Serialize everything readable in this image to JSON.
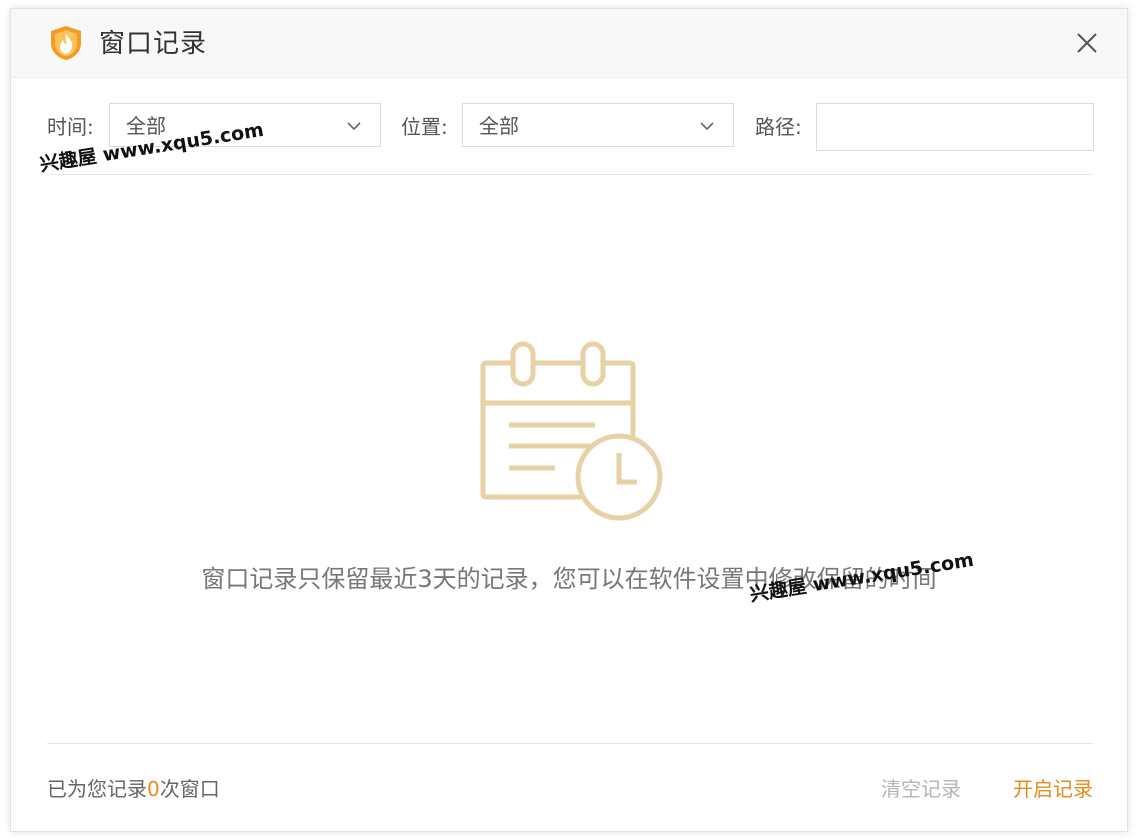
{
  "window": {
    "title": "窗口记录",
    "logo_icon": "shield-flame-icon",
    "close_icon": "close-icon"
  },
  "filters": {
    "time_label": "时间:",
    "time_value": "全部",
    "location_label": "位置:",
    "location_value": "全部",
    "path_label": "路径:",
    "path_value": "",
    "dropdown_icon": "chevron-down-icon"
  },
  "empty_state": {
    "icon": "calendar-clock-icon",
    "message": "窗口记录只保留最近3天的记录，您可以在软件设置中修改保留的时间"
  },
  "footer": {
    "status_prefix": "已为您记录",
    "status_count": "0",
    "status_suffix": "次窗口",
    "clear_label": "清空记录",
    "start_label": "开启记录"
  },
  "watermarks": {
    "top_left": "兴趣屋 www.xqu5.com",
    "center": "兴趣屋 www.xqu5.com"
  },
  "colors": {
    "accent": "#e58a1e",
    "count": "#ee8a1b",
    "disabled": "#b5b5b5",
    "illustration": "#e6d2a6"
  }
}
